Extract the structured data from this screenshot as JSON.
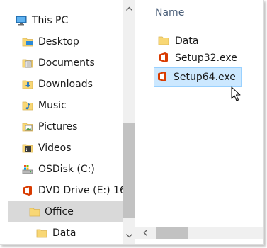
{
  "nav": {
    "items": [
      {
        "label": "This PC",
        "icon": "computer-icon"
      },
      {
        "label": "Desktop",
        "icon": "desktop-folder-icon"
      },
      {
        "label": "Documents",
        "icon": "documents-folder-icon"
      },
      {
        "label": "Downloads",
        "icon": "downloads-folder-icon"
      },
      {
        "label": "Music",
        "icon": "music-folder-icon"
      },
      {
        "label": "Pictures",
        "icon": "pictures-folder-icon"
      },
      {
        "label": "Videos",
        "icon": "videos-folder-icon"
      },
      {
        "label": "OSDisk (C:)",
        "icon": "drive-icon"
      },
      {
        "label": "DVD Drive (E:) 16.",
        "icon": "office-logo-icon"
      },
      {
        "label": "Office",
        "icon": "folder-icon",
        "selected": true
      },
      {
        "label": "Data",
        "icon": "folder-icon"
      }
    ]
  },
  "content": {
    "column_header": "Name",
    "files": [
      {
        "name": "Data",
        "icon": "folder-icon"
      },
      {
        "name": "Setup32.exe",
        "icon": "office-logo-icon"
      },
      {
        "name": "Setup64.exe",
        "icon": "office-logo-icon",
        "selected": true
      }
    ]
  },
  "colors": {
    "selection_fill": "#cce8ff",
    "selection_border": "#99d1ff",
    "nav_selected": "#d9d9d9",
    "folder_yellow": "#f8d775",
    "office_red": "#d83b01",
    "scrollbar": "#c2c2c2"
  }
}
